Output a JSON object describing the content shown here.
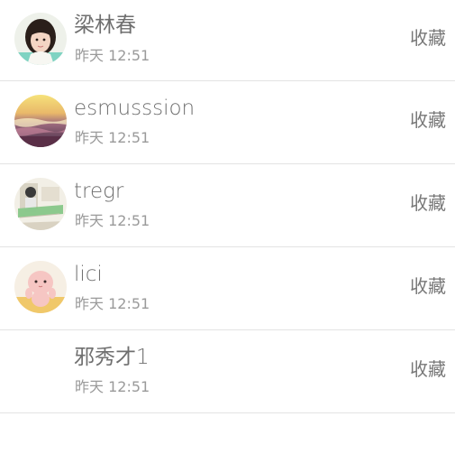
{
  "contacts": [
    {
      "name": "梁林春",
      "time": "昨天 12:51",
      "action_label": "收藏",
      "avatar_icon": "girl-portrait-avatar"
    },
    {
      "name": "esmusssion",
      "time": "昨天 12:51",
      "action_label": "收藏",
      "avatar_icon": "sunset-beach-avatar"
    },
    {
      "name": "tregr",
      "time": "昨天 12:51",
      "action_label": "收藏",
      "avatar_icon": "sketch-scene-avatar"
    },
    {
      "name": "lici",
      "time": "昨天 12:51",
      "action_label": "收藏",
      "avatar_icon": "baby-doll-avatar"
    },
    {
      "name": "邪秀才1",
      "time": "昨天 12:51",
      "action_label": "收藏",
      "avatar_icon": ""
    }
  ]
}
